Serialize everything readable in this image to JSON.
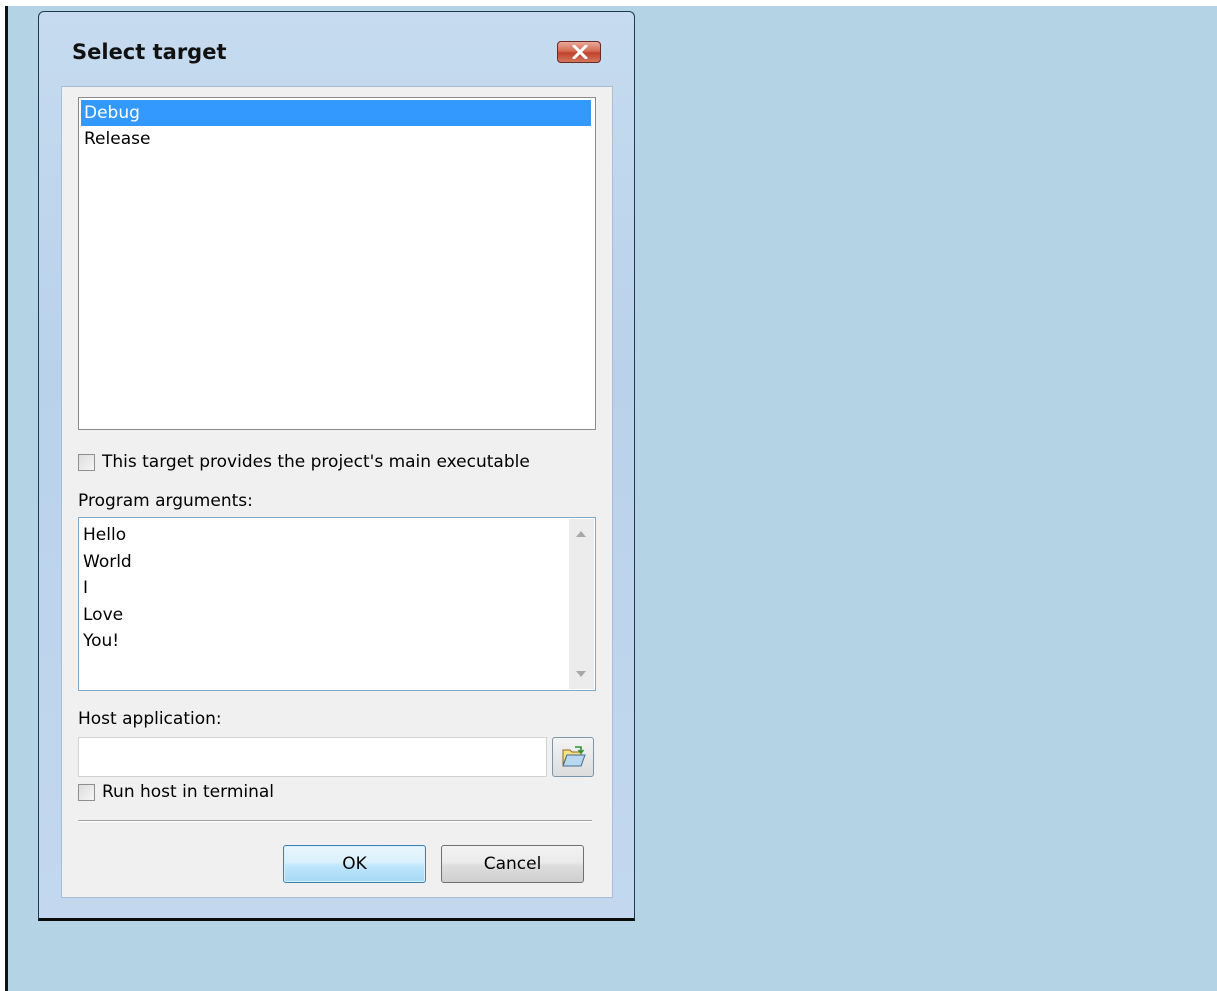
{
  "dialog": {
    "title": "Select target",
    "close_icon": "close-x-icon"
  },
  "targets": {
    "items": [
      {
        "label": "Debug",
        "selected": true
      },
      {
        "label": "Release",
        "selected": false
      }
    ]
  },
  "main_executable": {
    "label": "This target provides the project's main executable",
    "checked": false
  },
  "program_arguments": {
    "label": "Program arguments:",
    "lines": [
      "Hello",
      "World",
      "I",
      "Love",
      "You!"
    ]
  },
  "host_application": {
    "label": "Host application:",
    "value": "",
    "browse_icon": "folder-open-icon"
  },
  "run_in_terminal": {
    "label": "Run host in terminal",
    "checked": false
  },
  "buttons": {
    "ok": "OK",
    "cancel": "Cancel"
  },
  "colors": {
    "desktop": "#b4d4e6",
    "selection": "#3399ff"
  }
}
